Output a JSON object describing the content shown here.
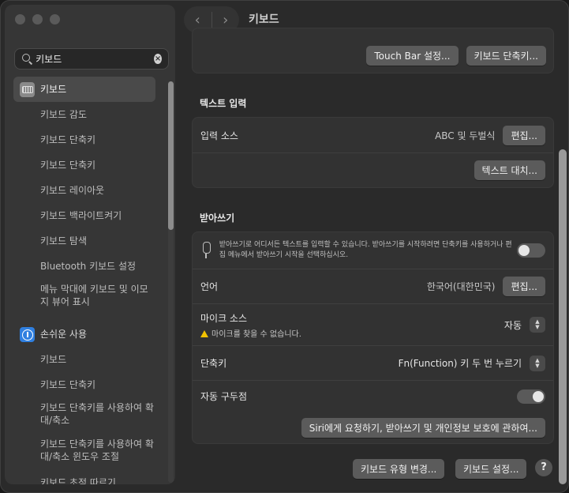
{
  "window": {
    "title": "키보드"
  },
  "search": {
    "value": "키보드"
  },
  "sidebar": {
    "items": [
      {
        "label": "키보드"
      },
      {
        "label": "키보드 감도"
      },
      {
        "label": "키보드 단축키"
      },
      {
        "label": "키보드 단축키"
      },
      {
        "label": "키보드 레이아웃"
      },
      {
        "label": "키보드 백라이트켜기"
      },
      {
        "label": "키보드 탐색"
      },
      {
        "label": "Bluetooth 키보드 설정"
      },
      {
        "label": "메뉴 막대에 키보드 및 이모지 뷰어 표시"
      },
      {
        "label": "손쉬운 사용"
      },
      {
        "label": "키보드"
      },
      {
        "label": "키보드 단축키"
      },
      {
        "label": "키보드 단축키를 사용하여 확대/축소"
      },
      {
        "label": "키보드 단축키를 사용하여 확대/축소 윈도우 조절"
      },
      {
        "label": "키보드 초점 따르기"
      }
    ]
  },
  "top_buttons": {
    "touchbar": "Touch Bar 설정...",
    "shortcuts": "키보드 단축키..."
  },
  "text_input": {
    "title": "텍스트 입력",
    "input_source_label": "입력 소스",
    "input_source_value": "ABC 및 두벌식",
    "edit_button": "편집...",
    "replace_button": "텍스트 대치..."
  },
  "dictation": {
    "title": "받아쓰기",
    "description": "받아쓰기로 어디서든 텍스트를 입력할 수 있습니다. 받아쓰기를 시작하려면 단축키를 사용하거나 편집 메뉴에서 받아쓰기 시작을 선택하십시오.",
    "toggle_state": "off",
    "language_label": "언어",
    "language_value": "한국어(대한민국)",
    "language_edit": "편집...",
    "mic_label": "마이크 소스",
    "mic_warning": "마이크를 찾을 수 없습니다.",
    "mic_value": "자동",
    "shortcut_label": "단축키",
    "shortcut_value": "Fn(Function) 키 두 번 누르기",
    "auto_punct_label": "자동 구두점",
    "auto_punct_state": "on",
    "siri_button": "Siri에게 요청하기, 받아쓰기 및 개인정보 보호에 관하여..."
  },
  "bottom": {
    "change_type": "키보드 유형 변경...",
    "setup": "키보드 설정...",
    "help": "?"
  }
}
